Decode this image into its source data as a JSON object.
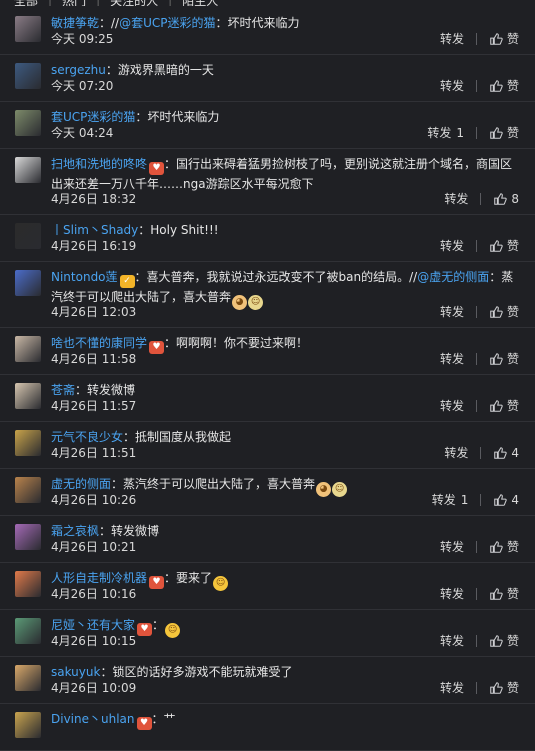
{
  "topbar": {
    "items": [
      "全部",
      "热门",
      "关注的人",
      "陌生人"
    ]
  },
  "actions": {
    "repost": "转发",
    "like": "赞"
  },
  "comments": [
    {
      "user": "敏捷筝乾",
      "badge": "",
      "parts": [
        {
          "t": "：//"
        },
        {
          "m": "@套UCP迷彩的猫"
        },
        {
          "t": "：坏时代来临力"
        }
      ],
      "time": "今天 09:25",
      "repost_count": "",
      "like_count": "",
      "avatar": "#8a7c86"
    },
    {
      "user": "sergezhu",
      "badge": "",
      "parts": [
        {
          "t": "：游戏界黑暗的一天"
        }
      ],
      "time": "今天 07:20",
      "repost_count": "",
      "like_count": "",
      "avatar": "#3d5a80"
    },
    {
      "user": "套UCP迷彩的猫",
      "badge": "",
      "parts": [
        {
          "t": "：坏时代来临力"
        }
      ],
      "time": "今天 04:24",
      "repost_count": "1",
      "like_count": "",
      "avatar": "#7d8b6a"
    },
    {
      "user": "扫地和洗地的咚咚",
      "badge": "red",
      "parts": [
        {
          "t": "：国行出来碍着猛男捡树枝了吗，更别说这就注册个域名，商国区出来还差一万八千年……nga游踪区水平每况愈下"
        }
      ],
      "time": "4月26日 18:32",
      "repost_count": "",
      "like_count": "8",
      "avatar": "#d8d8d8",
      "tall": true
    },
    {
      "user": "丨Slim丶Shady",
      "badge": "",
      "parts": [
        {
          "t": "：Holy Shit!!!"
        }
      ],
      "time": "4月26日 16:19",
      "repost_count": "",
      "like_count": "",
      "avatar": "#2b2b2b"
    },
    {
      "user": "Nintondo莲",
      "badge": "gold",
      "parts": [
        {
          "t": "：喜大普奔，我就说过永远改变不了被ban的结局。//"
        },
        {
          "m": "@虚无的侧面"
        },
        {
          "t": "：蒸汽终于可以爬出大陆了，喜大普奔"
        },
        {
          "e": "cat"
        },
        {
          "e": "pale"
        }
      ],
      "time": "4月26日 12:03",
      "repost_count": "",
      "like_count": "",
      "avatar": "#4b6cc9",
      "tall": true
    },
    {
      "user": "啥也不懂的康同学",
      "badge": "red",
      "parts": [
        {
          "t": "：啊啊啊！你不要过来啊！"
        }
      ],
      "time": "4月26日 11:58",
      "repost_count": "",
      "like_count": "",
      "avatar": "#c9b8a6"
    },
    {
      "user": "苍斋",
      "badge": "",
      "parts": [
        {
          "t": "：转发微博"
        }
      ],
      "time": "4月26日 11:57",
      "repost_count": "",
      "like_count": "",
      "avatar": "#d6c6b0"
    },
    {
      "user": "元气不良少女",
      "badge": "",
      "parts": [
        {
          "t": "：抵制国度从我做起"
        }
      ],
      "time": "4月26日 11:51",
      "repost_count": "",
      "like_count": "4",
      "avatar": "#c8a34a"
    },
    {
      "user": "虚无的侧面",
      "badge": "",
      "parts": [
        {
          "t": "：蒸汽终于可以爬出大陆了，喜大普奔"
        },
        {
          "e": "cat"
        },
        {
          "e": "pale"
        }
      ],
      "time": "4月26日 10:26",
      "repost_count": "1",
      "like_count": "4",
      "avatar": "#b9834c"
    },
    {
      "user": "霜之哀枫",
      "badge": "",
      "parts": [
        {
          "t": "：转发微博"
        }
      ],
      "time": "4月26日 10:21",
      "repost_count": "",
      "like_count": "",
      "avatar": "#a56ab7"
    },
    {
      "user": "人形自走制冷机器",
      "badge": "red",
      "parts": [
        {
          "t": "：要来了"
        },
        {
          "e": "yellow"
        }
      ],
      "time": "4月26日 10:16",
      "repost_count": "",
      "like_count": "",
      "avatar": "#e07a4a"
    },
    {
      "user": "尼娅丶还有大家",
      "badge": "red",
      "parts": [
        {
          "t": "："
        },
        {
          "e": "yellow"
        }
      ],
      "time": "4月26日 10:15",
      "repost_count": "",
      "like_count": "",
      "avatar": "#5b9a76"
    },
    {
      "user": "sakuyuk",
      "badge": "",
      "parts": [
        {
          "t": "：锁区的话好多游戏不能玩就难受了"
        }
      ],
      "time": "4月26日 10:09",
      "repost_count": "",
      "like_count": "",
      "avatar": "#d8a86a"
    },
    {
      "user": "Divine丶uhlan",
      "badge": "red",
      "parts": [
        {
          "t": "：艹"
        }
      ],
      "time": "",
      "repost_count": "",
      "like_count": "",
      "avatar": "#c9a44f"
    }
  ]
}
